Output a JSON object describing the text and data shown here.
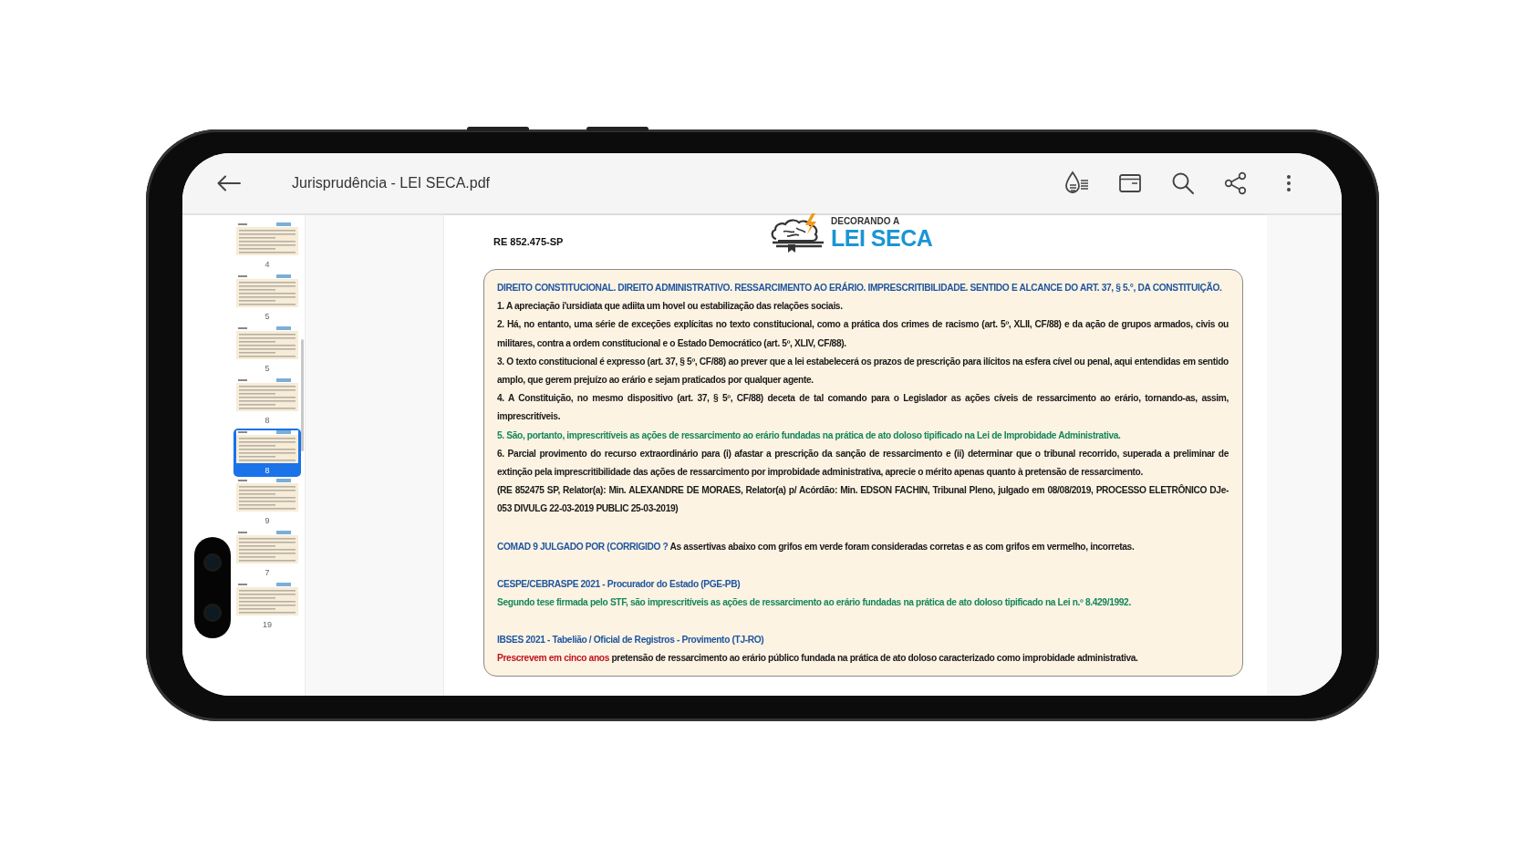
{
  "toolbar": {
    "title": "Jurisprudência - LEI SECA.pdf"
  },
  "thumbnails": [
    {
      "label": "4",
      "selected": false
    },
    {
      "label": "5",
      "selected": false
    },
    {
      "label": "5",
      "selected": false
    },
    {
      "label": "8",
      "selected": false
    },
    {
      "label": "8",
      "selected": true
    },
    {
      "label": "9",
      "selected": false
    },
    {
      "label": "7",
      "selected": false
    },
    {
      "label": "19",
      "selected": false
    }
  ],
  "page": {
    "case_number": "RE 852.475-SP",
    "logo": {
      "top_text": "DECORANDO A",
      "bottom_text": "LEI SECA"
    },
    "sections": [
      {
        "paragraphs": [
          {
            "runs": [
              {
                "text": "DIREITO CONSTITUCIONAL. DIREITO ADMINISTRATIVO. RESSARCIMENTO AO ERÁRIO. IMPRESCRITIBILIDADE. SENTIDO E ALCANCE DO ART. 37, § 5.°, DA CONSTITUIÇÃO.",
                "color": "#1f56a0"
              }
            ]
          },
          {
            "runs": [
              {
                "text": "1. A apreciação i'ursidiata que adiita um hovel ou estabilização das relações sociais.",
                "color": "#1a1a1a"
              }
            ]
          },
          {
            "runs": [
              {
                "text": "2. Há, no entanto, uma série de exceções explícitas no texto constitucional, como a prática dos crimes de racismo (art. 5º, XLII, CF/88) e da ação de grupos armados, civis ou militares, contra a ordem constitucional e o Estado Democrático (art. 5º, XLIV, CF/88).",
                "color": "#1a1a1a"
              }
            ]
          },
          {
            "runs": [
              {
                "text": "3. O texto constitucional é expresso (art. 37, § 5º, CF/88) ao prever que a lei estabelecerá os prazos de prescrição para ilícitos na esfera cível ou penal, aqui entendidas em sentido amplo, que gerem prejuízo ao erário e sejam praticados por qualquer agente.",
                "color": "#1a1a1a"
              }
            ]
          },
          {
            "runs": [
              {
                "text": "4. A Constituição, no mesmo dispositivo (art. 37, § 5º, CF/88) deceta de tal comando para o Legislador as ações cíveis de ressarcimento ao erário, tornando-as, assim, imprescritíveis.",
                "color": "#1a1a1a"
              }
            ]
          },
          {
            "runs": [
              {
                "text": "5. São, portanto, imprescritíveis as ações de ressarcimento ao erário fundadas na prática de ato doloso tipificado na Lei de Improbidade Administrativa.",
                "color": "#13875a"
              }
            ]
          },
          {
            "runs": [
              {
                "text": "6. Parcial provimento do recurso extraordinário para (i) afastar a prescrição da sanção de ressarcimento e (ii) determinar que o tribunal recorrido, superada a preliminar de extinção pela imprescritibilidade das ações de ressarcimento por improbidade administrativa, aprecie o mérito apenas quanto à pretensão de ressarcimento.",
                "color": "#1a1a1a"
              }
            ]
          },
          {
            "runs": [
              {
                "text": "(RE 852475 SP, Relator(a): Min. ALEXANDRE DE MORAES, Relator(a) p/ Acórdão: Min. EDSON FACHIN, Tribunal Pleno, julgado em 08/08/2019, PROCESSO ELETRÔNICO DJe-053 DIVULG 22-03-2019 PUBLIC 25-03-2019)",
                "color": "#1a1a1a"
              }
            ]
          }
        ]
      },
      {
        "paragraphs": [
          {
            "runs": [
              {
                "text": "COMAD 9 JULGADO POR (CORRIGIDO ?",
                "color": "#1f56a0"
              },
              {
                "text": " As assertivas abaixo com grifos em verde foram consideradas corretas e as com grifos em vermelho, incorretas.",
                "color": "#1a1a1a"
              }
            ]
          }
        ]
      },
      {
        "paragraphs": [
          {
            "runs": [
              {
                "text": "CESPE/CEBRASPE 2021 - Procurador do Estado (PGE-PB)",
                "color": "#1f56a0"
              }
            ]
          },
          {
            "runs": [
              {
                "text": "Segundo tese firmada pelo STF, são imprescritíveis as ações de ressarcimento ao erário fundadas na prática de ato doloso tipificado na Lei n.º 8.429/1992.",
                "color": "#13875a"
              }
            ]
          }
        ]
      },
      {
        "paragraphs": [
          {
            "runs": [
              {
                "text": "IBSES 2021 - Tabelião / Oficial de Registros - Provimento (TJ-RO)",
                "color": "#1f56a0"
              }
            ]
          },
          {
            "runs": [
              {
                "text": "Prescrevem em cinco anos",
                "color": "#c0121b"
              },
              {
                "text": " pretensão de ressarcimento ao erário público fundada na prática de ato doloso caracterizado como improbidade administrativa.",
                "color": "#1a1a1a"
              }
            ]
          }
        ]
      }
    ]
  }
}
